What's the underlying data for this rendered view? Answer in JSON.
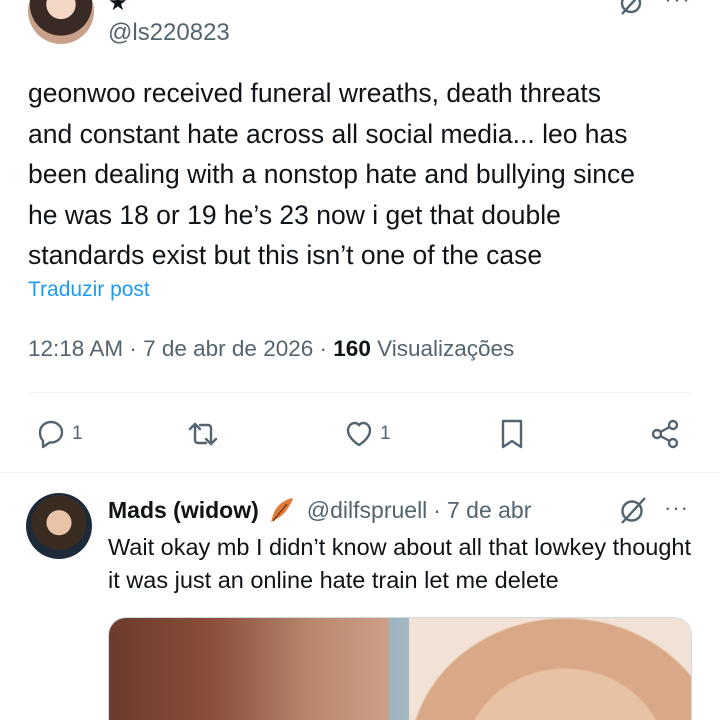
{
  "main_tweet": {
    "handle": "@ls220823",
    "text": "geonwoo received funeral wreaths, death threats\nand constant hate across all social media... leo has\nbeen dealing with a nonstop hate and bullying since\nhe was 18 or 19 he’s 23 now i get that double\nstandards exist but this isn’t one of the case",
    "translate_label": "Traduzir post",
    "time": "12:18 AM",
    "date": "7 de abr de 2026",
    "separator": "·",
    "views_count": "160",
    "views_label": "Visualizações",
    "actions": {
      "reply_count": "1",
      "retweet_count": "",
      "like_count": "1"
    }
  },
  "reply_tweet": {
    "name": "Mads (widow)",
    "handle": "@dilfspruell",
    "separator": "·",
    "date": "7 de abr",
    "text": "Wait okay mb I didn’t know about all that lowkey thought it was just an online hate train let me delete"
  },
  "icons": {
    "more": "···",
    "star": "★"
  },
  "colors": {
    "link": "#1d9bf0",
    "secondary_text": "#536471",
    "primary_text": "#0f1419",
    "divider": "#eff3f4"
  }
}
